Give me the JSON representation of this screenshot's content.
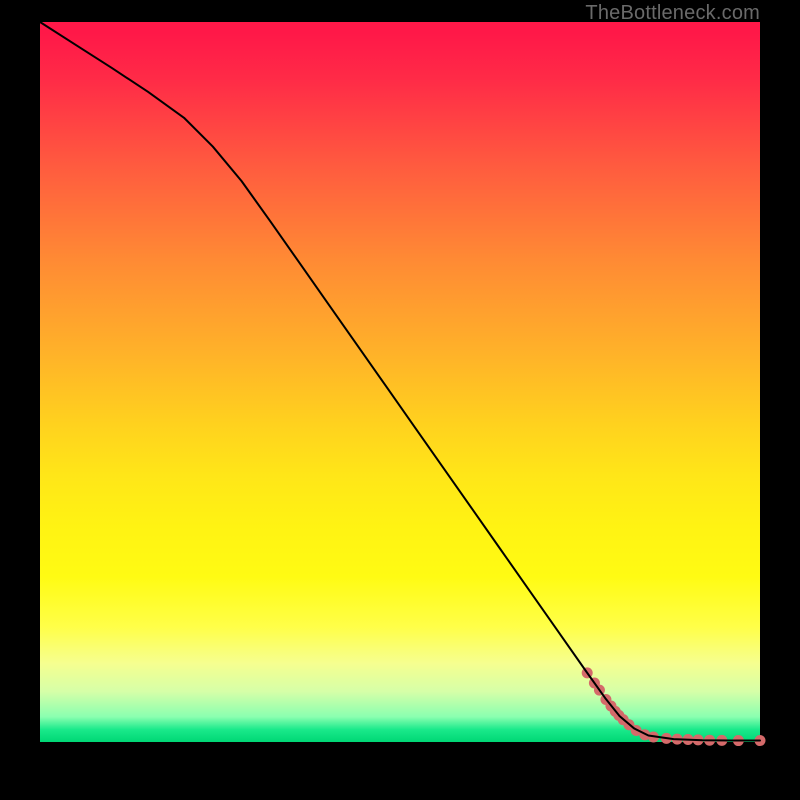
{
  "watermark": "TheBottleneck.com",
  "chart_data": {
    "type": "line",
    "title": "",
    "xlabel": "",
    "ylabel": "",
    "xlim": [
      0,
      100
    ],
    "ylim": [
      0,
      100
    ],
    "grid": false,
    "legend": false,
    "series": [
      {
        "name": "curve",
        "color": "#000000",
        "stroke_width": 2,
        "x": [
          0,
          5,
          10,
          15,
          20,
          24,
          28,
          32,
          36,
          40,
          44,
          48,
          52,
          56,
          60,
          64,
          68,
          72,
          76,
          78.5,
          80.5,
          82.5,
          84.5,
          88,
          92,
          96,
          100
        ],
        "y": [
          100,
          96.8,
          93.6,
          90.3,
          86.7,
          82.7,
          77.9,
          72.3,
          66.6,
          60.9,
          55.2,
          49.5,
          43.8,
          38.1,
          32.4,
          26.7,
          21.0,
          15.3,
          9.6,
          6.1,
          3.6,
          1.9,
          0.9,
          0.4,
          0.25,
          0.2,
          0.2
        ]
      }
    ],
    "scatter": {
      "name": "dots",
      "color": "#d46a6a",
      "radius": 5.5,
      "points": [
        {
          "x": 76.0,
          "y": 9.6
        },
        {
          "x": 77.0,
          "y": 8.2
        },
        {
          "x": 77.7,
          "y": 7.2
        },
        {
          "x": 78.6,
          "y": 5.9
        },
        {
          "x": 79.3,
          "y": 5.0
        },
        {
          "x": 79.9,
          "y": 4.25
        },
        {
          "x": 80.4,
          "y": 3.7
        },
        {
          "x": 81.0,
          "y": 3.1
        },
        {
          "x": 81.8,
          "y": 2.4
        },
        {
          "x": 82.8,
          "y": 1.6
        },
        {
          "x": 84.0,
          "y": 1.0
        },
        {
          "x": 85.2,
          "y": 0.7
        },
        {
          "x": 87.0,
          "y": 0.5
        },
        {
          "x": 88.5,
          "y": 0.4
        },
        {
          "x": 90.0,
          "y": 0.35
        },
        {
          "x": 91.4,
          "y": 0.3
        },
        {
          "x": 93.0,
          "y": 0.25
        },
        {
          "x": 94.7,
          "y": 0.22
        },
        {
          "x": 97.0,
          "y": 0.2
        },
        {
          "x": 100.0,
          "y": 0.2
        }
      ]
    }
  }
}
